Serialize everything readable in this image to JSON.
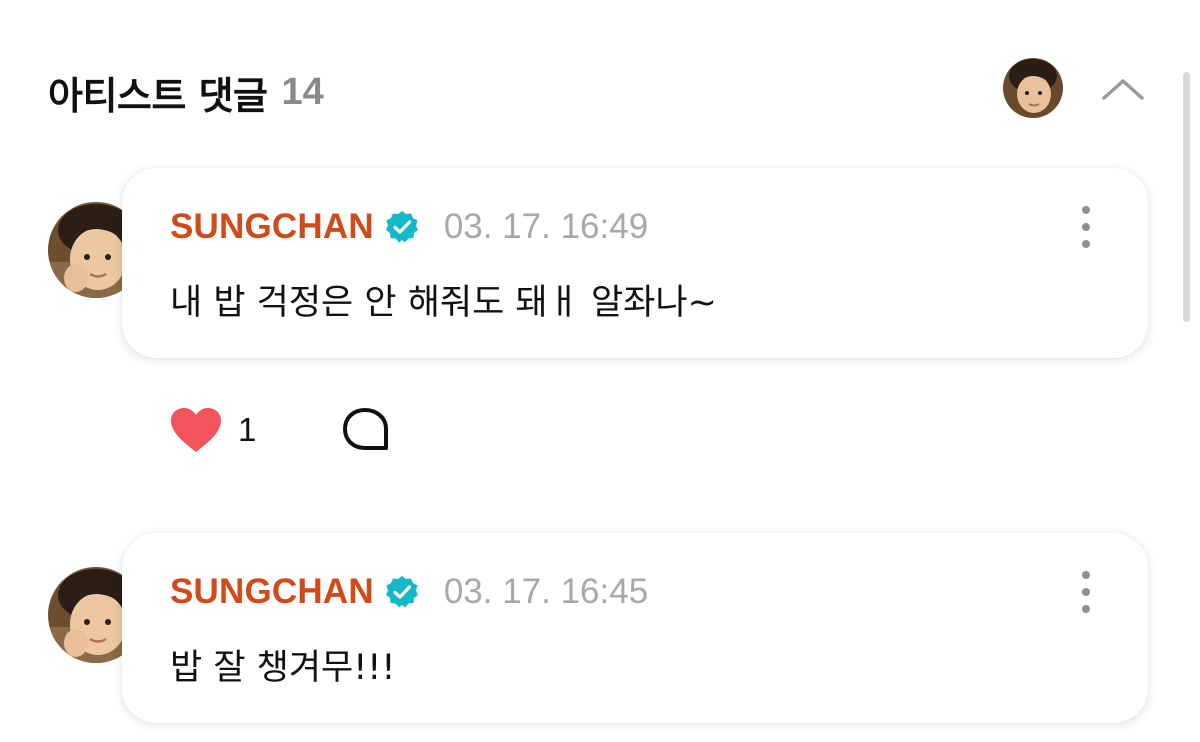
{
  "header": {
    "title": "아티스트 댓글",
    "count": "14"
  },
  "colors": {
    "author": "#d2491a",
    "verified": "#14b8c9",
    "heart": "#f2545b",
    "timestamp": "#a8a8a8",
    "count": "#8a8a8a"
  },
  "icons": {
    "header_avatar": "avatar",
    "collapse": "chevron-up-icon",
    "verified": "verified-badge-icon",
    "more": "more-vertical-icon",
    "like": "heart-icon",
    "reply": "speech-bubble-icon"
  },
  "comments": [
    {
      "author": "SUNGCHAN",
      "time": "03. 17. 16:49",
      "text": "내 밥 걱정은 안 해줘도 돼ㅐ  알좌나~",
      "likes": "1"
    },
    {
      "author": "SUNGCHAN",
      "time": "03. 17. 16:45",
      "text": "밥 잘 챙겨무!!!"
    }
  ]
}
